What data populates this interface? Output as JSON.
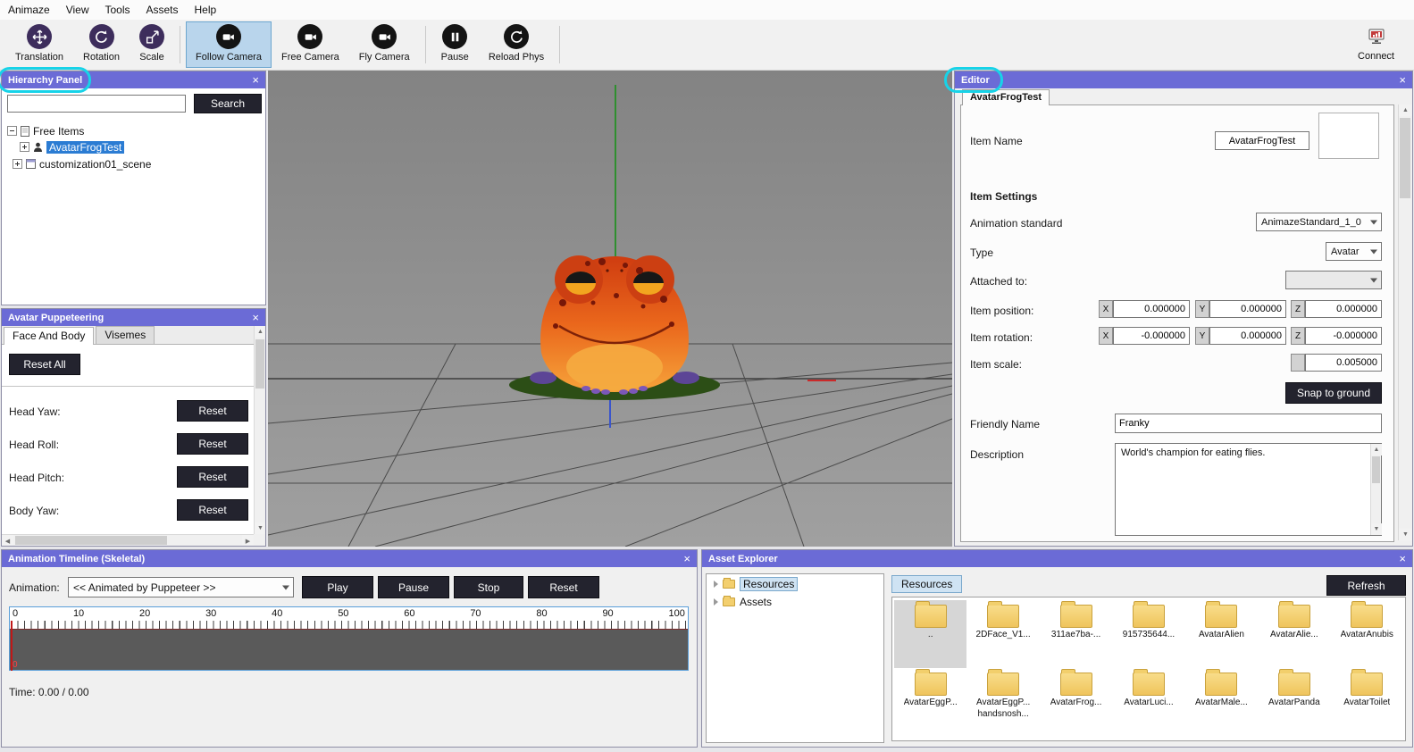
{
  "icons": {
    "close": "×",
    "scroll_up": "▲",
    "scroll_down": "▼",
    "scroll_left": "◀",
    "scroll_right": "▶"
  },
  "menu": {
    "items": [
      "Animaze",
      "View",
      "Tools",
      "Assets",
      "Help"
    ]
  },
  "toolbar": {
    "buttons": [
      {
        "label": "Translation"
      },
      {
        "label": "Rotation"
      },
      {
        "label": "Scale"
      },
      {
        "label": "Follow Camera",
        "selected": true
      },
      {
        "label": "Free Camera"
      },
      {
        "label": "Fly Camera"
      },
      {
        "label": "Pause"
      },
      {
        "label": "Reload Phys"
      }
    ],
    "connect": {
      "label": "Connect"
    }
  },
  "hierarchy_panel": {
    "title": "Hierarchy Panel",
    "search": {
      "value": "",
      "button": "Search"
    },
    "tree": [
      {
        "label": "Free Items"
      },
      {
        "label": "AvatarFrogTest",
        "selected": true
      },
      {
        "label": "customization01_scene"
      }
    ]
  },
  "puppeteering_panel": {
    "title": "Avatar Puppeteering",
    "tabs": [
      {
        "label": "Face And Body",
        "active": true
      },
      {
        "label": "Visemes"
      }
    ],
    "reset_all": "Reset All",
    "rows": [
      {
        "label": "Head Yaw:",
        "button": "Reset"
      },
      {
        "label": "Head Roll:",
        "button": "Reset"
      },
      {
        "label": "Head Pitch:",
        "button": "Reset"
      },
      {
        "label": "Body Yaw:",
        "button": "Reset"
      }
    ]
  },
  "editor_panel": {
    "title": "Editor",
    "tab": "AvatarFrogTest",
    "item_name": {
      "label": "Item Name",
      "value": "AvatarFrogTest"
    },
    "settings_heading": "Item Settings",
    "animation_standard": {
      "label": "Animation standard",
      "value": "AnimazeStandard_1_0"
    },
    "type": {
      "label": "Type",
      "value": "Avatar"
    },
    "attached_to": {
      "label": "Attached to:",
      "value": ""
    },
    "axis": {
      "x": "X",
      "y": "Y",
      "z": "Z"
    },
    "item_position": {
      "label": "Item position:",
      "x": "0.000000",
      "y": "0.000000",
      "z": "0.000000"
    },
    "item_rotation": {
      "label": "Item rotation:",
      "x": "-0.000000",
      "y": "0.000000",
      "z": "-0.000000"
    },
    "item_scale": {
      "label": "Item scale:",
      "value": "0.005000"
    },
    "snap_button": "Snap to ground",
    "friendly_name": {
      "label": "Friendly Name",
      "value": "Franky"
    },
    "description": {
      "label": "Description",
      "value": "World's champion for eating flies."
    }
  },
  "timeline_panel": {
    "title": "Animation Timeline (Skeletal)",
    "animation_label": "Animation:",
    "animation_value": "<< Animated by Puppeteer >>",
    "buttons": [
      "Play",
      "Pause",
      "Stop",
      "Reset"
    ],
    "ruler": [
      "0",
      "10",
      "20",
      "30",
      "40",
      "50",
      "60",
      "70",
      "80",
      "90",
      "100"
    ],
    "playhead_label": "0",
    "time_text": "Time: 0.00 / 0.00"
  },
  "asset_explorer": {
    "title": "Asset Explorer",
    "tree": [
      {
        "label": "Resources",
        "selected": true
      },
      {
        "label": "Assets"
      }
    ],
    "tab": "Resources",
    "refresh_button": "Refresh",
    "folders": [
      {
        "label": "..",
        "selected": true
      },
      {
        "label": "2DFace_V1..."
      },
      {
        "label": "311ae7ba-..."
      },
      {
        "label": "915735644..."
      },
      {
        "label": "AvatarAlien"
      },
      {
        "label": "AvatarAlie..."
      },
      {
        "label": "AvatarAnubis"
      },
      {
        "label": "AvatarEggP..."
      },
      {
        "label": "AvatarEggP...",
        "label2": "handsnosh..."
      },
      {
        "label": "AvatarFrog..."
      },
      {
        "label": "AvatarLuci..."
      },
      {
        "label": "AvatarMale..."
      },
      {
        "label": "AvatarPanda"
      },
      {
        "label": "AvatarToilet"
      }
    ]
  }
}
